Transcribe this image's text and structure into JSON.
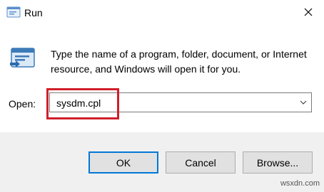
{
  "window": {
    "title": "Run",
    "title_icon": "run-icon",
    "close_icon": "close-icon"
  },
  "body": {
    "app_icon": "run-app-icon",
    "description": "Type the name of a program, folder, document, or Internet resource, and Windows will open it for you."
  },
  "open_field": {
    "label": "Open:",
    "value": "sysdm.cpl",
    "highlight_color": "#d01f2b"
  },
  "buttons": {
    "ok": "OK",
    "cancel": "Cancel",
    "browse": "Browse..."
  },
  "watermark": "wsxdn.com",
  "colors": {
    "accent": "#0078d7",
    "footer_bg": "#f0f0f0"
  }
}
